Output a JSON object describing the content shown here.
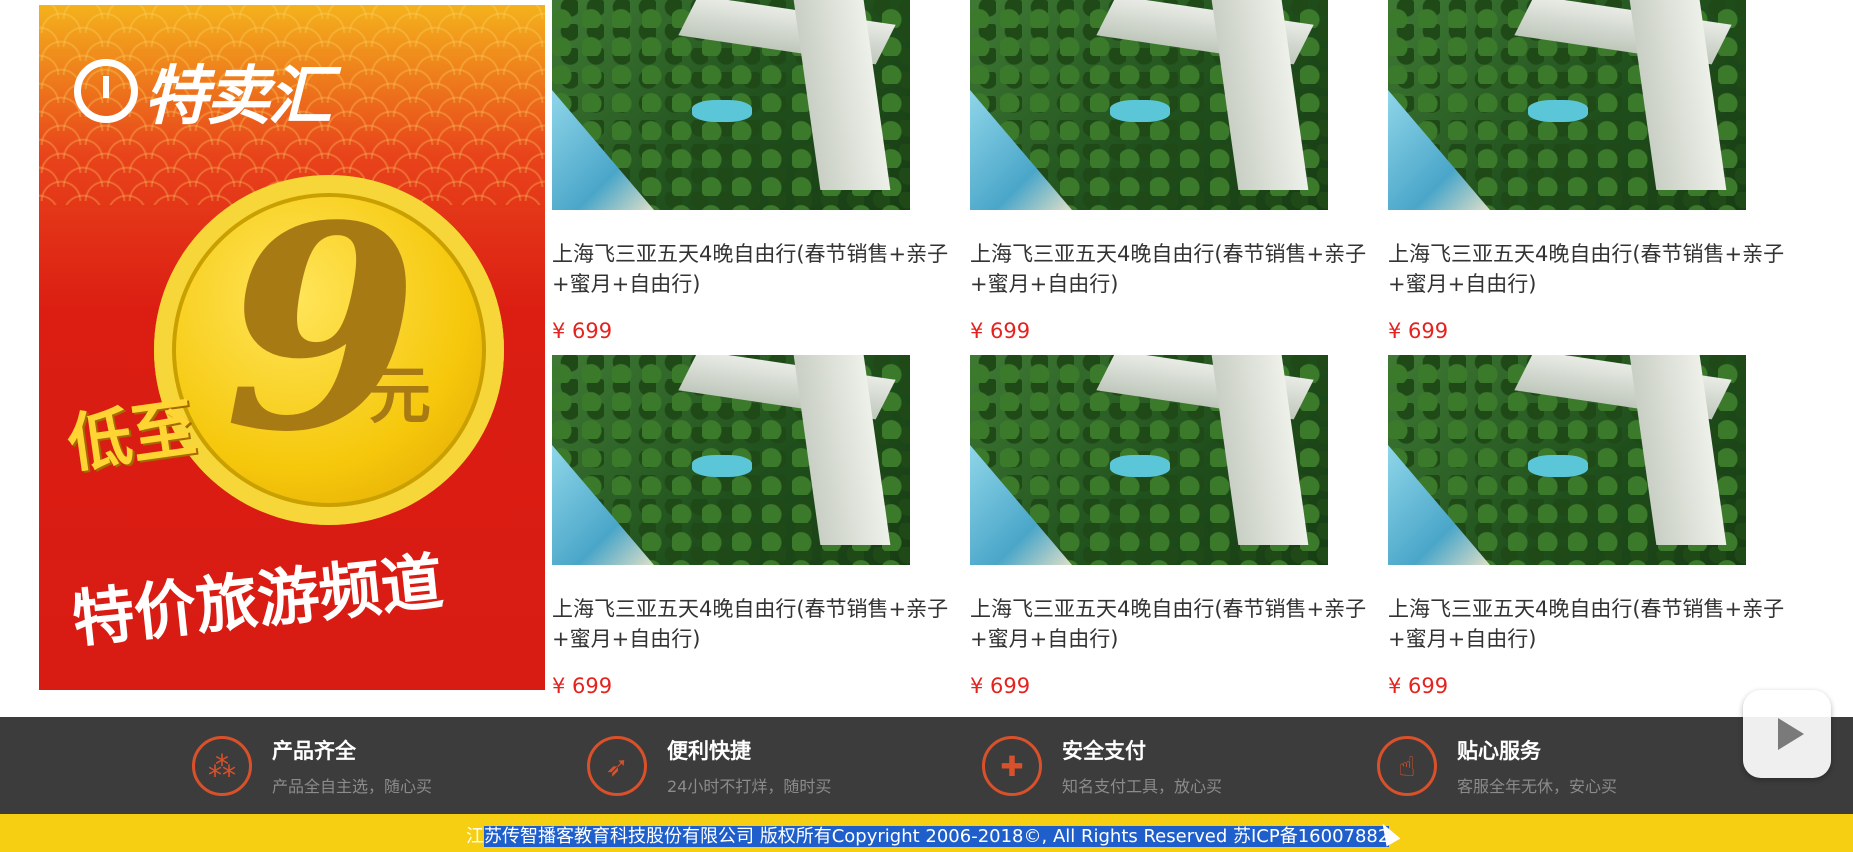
{
  "promo": {
    "brand": "特卖汇",
    "low_to": "低至",
    "price_number": "9",
    "price_unit": "元",
    "channel": "特价旅游频道"
  },
  "products": [
    {
      "title": "上海飞三亚五天4晚自由行(春节销售+亲子+蜜月+自由行)",
      "price": "¥ 699"
    },
    {
      "title": "上海飞三亚五天4晚自由行(春节销售+亲子+蜜月+自由行)",
      "price": "¥ 699"
    },
    {
      "title": "上海飞三亚五天4晚自由行(春节销售+亲子+蜜月+自由行)",
      "price": "¥ 699"
    },
    {
      "title": "上海飞三亚五天4晚自由行(春节销售+亲子+蜜月+自由行)",
      "price": "¥ 699"
    },
    {
      "title": "上海飞三亚五天4晚自由行(春节销售+亲子+蜜月+自由行)",
      "price": "¥ 699"
    },
    {
      "title": "上海飞三亚五天4晚自由行(春节销售+亲子+蜜月+自由行)",
      "price": "¥ 699"
    }
  ],
  "features": [
    {
      "icon": "grid-icon",
      "title": "产品齐全",
      "desc": "产品全自主选，随心买"
    },
    {
      "icon": "rocket-icon",
      "title": "便利快捷",
      "desc": "24小时不打烊，随时买"
    },
    {
      "icon": "shield-icon",
      "title": "安全支付",
      "desc": "知名支付工具，放心买"
    },
    {
      "icon": "thumbs-up-icon",
      "title": "贴心服务",
      "desc": "客服全年无休，安心买"
    }
  ],
  "footer": {
    "prefix": "江",
    "copyright": "苏传智播客教育科技股份有限公司 版权所有Copyright 2006-2018©, All Rights Reserved 苏ICP备16007882"
  },
  "colors": {
    "price": "#e4231f",
    "feature_bar": "#3c3c3c",
    "feature_accent": "#d9512a",
    "footer_bg": "#f6cf12"
  }
}
